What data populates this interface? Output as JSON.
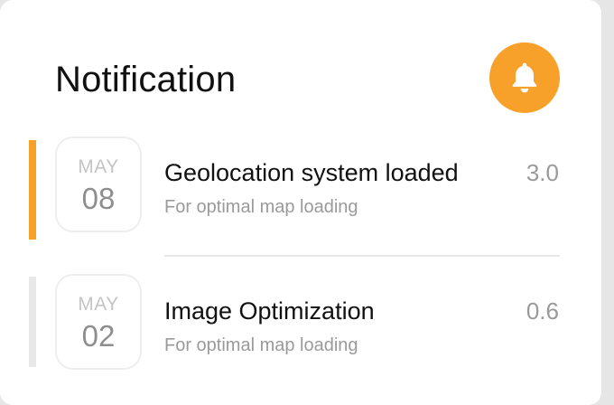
{
  "header": {
    "title": "Notification",
    "bell_color": "#f7a12b"
  },
  "notifications": [
    {
      "month": "MAY",
      "day": "08",
      "title": "Geolocation system loaded",
      "subtitle": "For optimal map loading",
      "value": "3.0",
      "accent_color": "#f7a12b"
    },
    {
      "month": "MAY",
      "day": "02",
      "title": "Image Optimization",
      "subtitle": "For optimal map loading",
      "value": "0.6",
      "accent_color": "#e8e8e8"
    }
  ]
}
